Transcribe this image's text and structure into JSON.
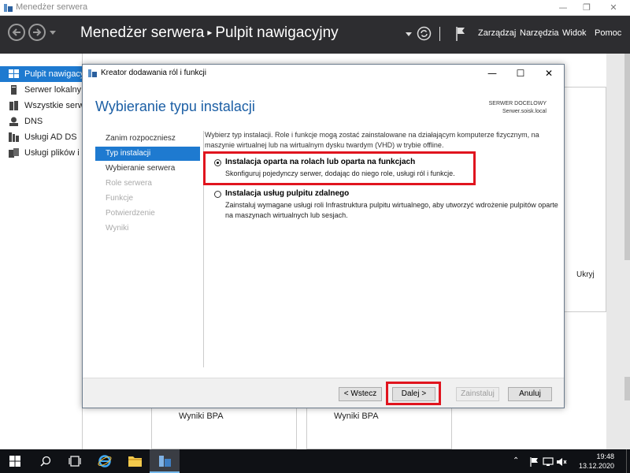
{
  "window": {
    "title": "Menedżer serwera",
    "minimize_glyph": "—",
    "restore_glyph": "❐",
    "close_glyph": "✕"
  },
  "header": {
    "breadcrumb_root": "Menedżer serwera",
    "breadcrumb_separator": "▸",
    "breadcrumb_page": "Pulpit nawigacyjny",
    "menu": [
      "Zarządzaj",
      "Narzędzia",
      "Widok",
      "Pomoc"
    ]
  },
  "sidebar": {
    "items": [
      {
        "label": "Pulpit nawigacyjny",
        "icon": "dashboard-icon"
      },
      {
        "label": "Serwer lokalny",
        "icon": "server-icon"
      },
      {
        "label": "Wszystkie serwery",
        "icon": "servers-icon"
      },
      {
        "label": "DNS",
        "icon": "dns-icon"
      },
      {
        "label": "Usługi AD DS",
        "icon": "ad-icon"
      },
      {
        "label": "Usługi plików i magazynowania",
        "icon": "files-icon"
      }
    ]
  },
  "background": {
    "hide_label": "Ukryj",
    "bpa_results_1": "Wyniki BPA",
    "bpa_results_2": "Wyniki BPA"
  },
  "wizard": {
    "title": "Kreator dodawania ról i funkcji",
    "heading": "Wybieranie typu instalacji",
    "destination_label": "SERWER DOCELOWY",
    "destination_server": "Serwer.soisk.local",
    "steps": [
      {
        "label": "Zanim rozpoczniesz",
        "state": "done"
      },
      {
        "label": "Typ instalacji",
        "state": "active"
      },
      {
        "label": "Wybieranie serwera",
        "state": "enabled"
      },
      {
        "label": "Role serwera",
        "state": "disabled"
      },
      {
        "label": "Funkcje",
        "state": "disabled"
      },
      {
        "label": "Potwierdzenie",
        "state": "disabled"
      },
      {
        "label": "Wyniki",
        "state": "disabled"
      }
    ],
    "intro": "Wybierz typ instalacji. Role i funkcje mogą zostać zainstalowane na działającym komputerze fizycznym, na maszynie wirtualnej lub na wirtualnym dysku twardym (VHD) w trybie offline.",
    "options": [
      {
        "title": "Instalacja oparta na rolach lub oparta na funkcjach",
        "description": "Skonfiguruj pojedynczy serwer, dodając do niego role, usługi ról i funkcje.",
        "selected": true
      },
      {
        "title": "Instalacja usług pulpitu zdalnego",
        "description": "Zainstaluj wymagane usługi roli Infrastruktura pulpitu wirtualnego, aby utworzyć wdrożenie pulpitów oparte na maszynach wirtualnych lub sesjach.",
        "selected": false
      }
    ],
    "buttons": {
      "back": "< Wstecz",
      "next": "Dalej >",
      "install": "Zainstaluj",
      "cancel": "Anuluj"
    },
    "minimize_glyph": "—",
    "maximize_glyph": "☐",
    "close_glyph": "✕"
  },
  "taskbar": {
    "time": "19:48",
    "date": "13.12.2020"
  },
  "colors": {
    "accent": "#1e7ad0",
    "header_bg": "#2d2d30",
    "highlight": "#e0141e",
    "heading": "#1c5fa5"
  }
}
